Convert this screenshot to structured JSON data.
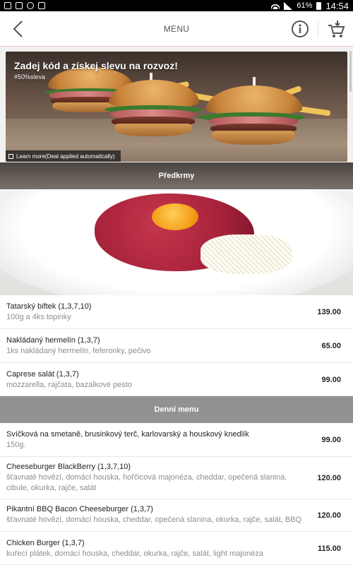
{
  "status_bar": {
    "battery": "61%",
    "time": "14:54"
  },
  "header": {
    "title": "MENU",
    "back_icon": "chevron-left-icon",
    "info_icon": "info-icon",
    "cart_icon": "cart-add-icon",
    "border_color": "#e6c9c4"
  },
  "promo": {
    "title": "Zadej kód a získej slevu na rozvoz!",
    "tag": "#50%sleva",
    "learn_more": "Learn more(Deal applied automatically)"
  },
  "sections": [
    {
      "title": "Předkrmy",
      "items": [
        {
          "name": "Tatarský biftek (1,3,7,10)",
          "desc": "100g a 4ks topinky",
          "price": "139.00"
        },
        {
          "name": "Nakládaný hermelín (1,3,7)",
          "desc": "1ks nakládaný hermelín, feferonky, pečivo",
          "price": "65.00"
        },
        {
          "name": "Caprese salát (1,3,7)",
          "desc": "mozzarella, rajčata, bazalkové pesto",
          "price": "99.00"
        }
      ]
    },
    {
      "title": "Denní menu",
      "items": [
        {
          "name": "Svíčková na smetaně, brusinkový terč, karlovarský a houskový knedlík",
          "desc": "150g.",
          "price": "99.00"
        },
        {
          "name": "Cheeseburger BlackBerry (1,3,7,10)",
          "desc": "šťavnaté hovězí, domácí houska, hořčicová majonéza, cheddar, opečená slanina, cibule, okurka, rajče, salát",
          "price": "120.00"
        },
        {
          "name": "Pikantní BBQ Bacon Cheeseburger (1,3,7)",
          "desc": "šťavnaté hovězí, domácí houska, cheddar, opečená slanina, okurka, rajče, salát, BBQ",
          "price": "120.00"
        },
        {
          "name": "Chicken Burger (1,3,7)",
          "desc": "kuřecí plátek, domácí houska, cheddar, okurka, rajče, salát, light majonéza",
          "price": "115.00"
        }
      ]
    }
  ]
}
